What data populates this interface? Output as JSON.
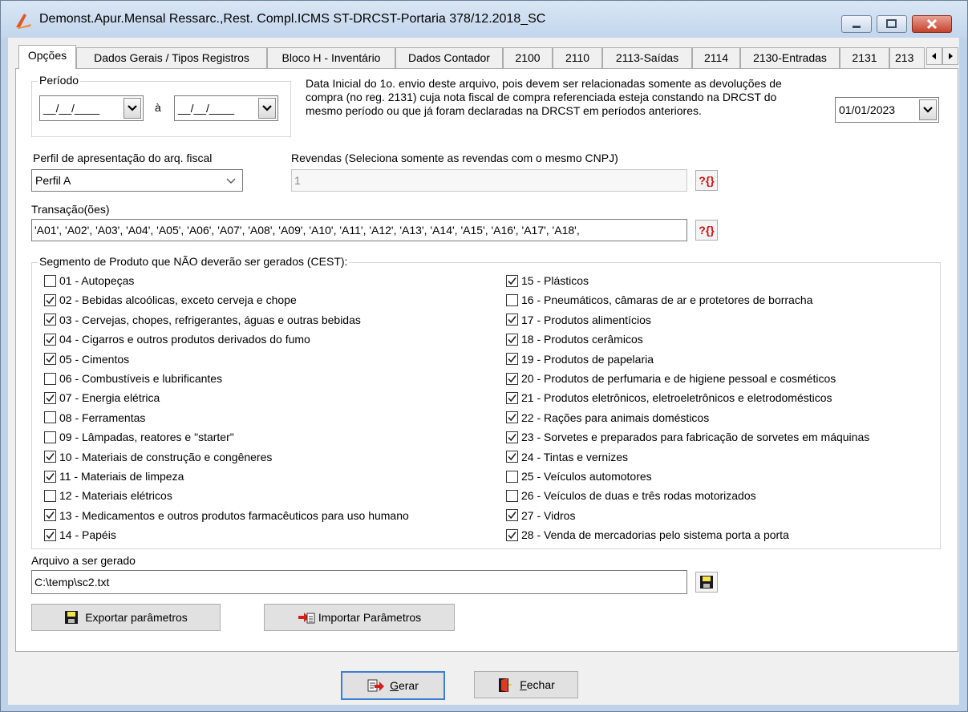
{
  "window": {
    "title": "Demonst.Apur.Mensal Ressarc.,Rest. Compl.ICMS ST-DRCST-Portaria 378/12.2018_SC"
  },
  "tabs": [
    {
      "label": "Opções",
      "active": true
    },
    {
      "label": "Dados Gerais / Tipos Registros"
    },
    {
      "label": "Bloco H - Inventário"
    },
    {
      "label": "Dados Contador"
    },
    {
      "label": "2100"
    },
    {
      "label": "2110"
    },
    {
      "label": "2113-Saídas"
    },
    {
      "label": "2114"
    },
    {
      "label": "2130-Entradas"
    },
    {
      "label": "2131"
    },
    {
      "label": "213"
    }
  ],
  "periodo": {
    "legend": "Período",
    "start": "__/__/____",
    "separator": "à",
    "end": "__/__/____"
  },
  "data_inicial": {
    "note": "Data Inicial do 1o. envio deste arquivo, pois devem ser relacionadas somente as devoluções de compra (no reg. 2131) cuja nota fiscal de compra referenciada esteja constando na DRCST do mesmo período ou que já foram declaradas na DRCST em períodos anteriores.",
    "value": "01/01/2023"
  },
  "perfil": {
    "label": "Perfil de apresentação do arq. fiscal",
    "value": "Perfil A"
  },
  "revendas": {
    "label": "Revendas (Seleciona somente as revendas com o mesmo CNPJ)",
    "value": "1"
  },
  "transacoes": {
    "label": "Transação(ões)",
    "value": "'A01', 'A02', 'A03', 'A04', 'A05', 'A06', 'A07', 'A08', 'A09', 'A10', 'A11', 'A12', 'A13', 'A14', 'A15', 'A16', 'A17', 'A18',"
  },
  "segmento": {
    "legend": "Segmento de Produto que NÃO deverão ser gerados (CEST):",
    "left": [
      {
        "label": "01 - Autopeças",
        "checked": false
      },
      {
        "label": "02 - Bebidas alcoólicas, exceto cerveja e chope",
        "checked": true
      },
      {
        "label": "03 - Cervejas, chopes, refrigerantes, águas e outras bebidas",
        "checked": true
      },
      {
        "label": "04 - Cigarros e outros produtos derivados do fumo",
        "checked": true
      },
      {
        "label": "05 - Cimentos",
        "checked": true
      },
      {
        "label": "06 - Combustíveis e lubrificantes",
        "checked": false
      },
      {
        "label": "07 - Energia elétrica",
        "checked": true
      },
      {
        "label": "08 - Ferramentas",
        "checked": false
      },
      {
        "label": "09 - Lâmpadas, reatores e \"starter\"",
        "checked": false
      },
      {
        "label": "10 - Materiais de construção e congêneres",
        "checked": true
      },
      {
        "label": "11 - Materiais de limpeza",
        "checked": true
      },
      {
        "label": "12 - Materiais elétricos",
        "checked": false
      },
      {
        "label": "13 - Medicamentos e outros produtos farmacêuticos para uso humano",
        "checked": true
      },
      {
        "label": "14 - Papéis",
        "checked": true
      }
    ],
    "right": [
      {
        "label": "15 - Plásticos",
        "checked": true
      },
      {
        "label": "16 - Pneumáticos, câmaras de ar e protetores de borracha",
        "checked": false
      },
      {
        "label": "17 - Produtos alimentícios",
        "checked": true
      },
      {
        "label": "18 - Produtos cerâmicos",
        "checked": true
      },
      {
        "label": "19 - Produtos de papelaria",
        "checked": true
      },
      {
        "label": "20 - Produtos de perfumaria e de higiene pessoal e cosméticos",
        "checked": true
      },
      {
        "label": "21 - Produtos eletrônicos, eletroeletrônicos e eletrodomésticos",
        "checked": true
      },
      {
        "label": "22 - Rações para animais domésticos",
        "checked": true
      },
      {
        "label": "23 - Sorvetes e preparados para fabricação de sorvetes em máquinas",
        "checked": true
      },
      {
        "label": "24 - Tintas e vernizes",
        "checked": true
      },
      {
        "label": "25 - Veículos automotores",
        "checked": false
      },
      {
        "label": "26 - Veículos de duas e três rodas motorizados",
        "checked": false
      },
      {
        "label": "27 - Vidros",
        "checked": true
      },
      {
        "label": "28 - Venda de mercadorias pelo sistema porta a porta",
        "checked": true
      }
    ]
  },
  "arquivo": {
    "label": "Arquivo a ser gerado",
    "value": "C:\\temp\\sc2.txt"
  },
  "buttons": {
    "exportar": "Exportar parâmetros",
    "importar": "Importar Parâmetros",
    "gerar_first": "G",
    "gerar_rest": "erar",
    "fechar_first": "F",
    "fechar_rest": "echar"
  },
  "help_glyph": "?{}"
}
